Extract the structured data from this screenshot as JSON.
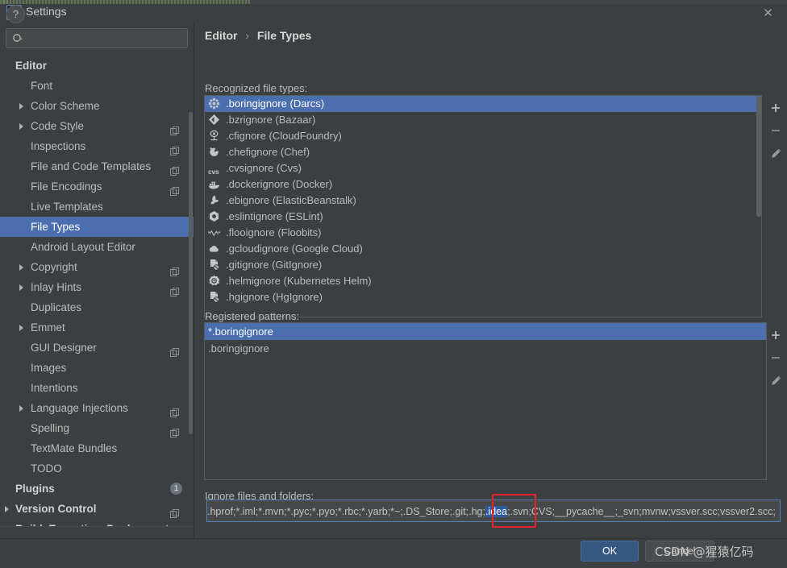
{
  "window": {
    "title": "Settings",
    "app_icon": "intellij-idea-icon",
    "close_icon": "close-icon"
  },
  "search": {
    "placeholder": "",
    "value": "",
    "icon": "search-icon"
  },
  "sidebar": {
    "scroll_present": true,
    "items": [
      {
        "label": "Editor",
        "level": 0,
        "bold": true,
        "arrow": false,
        "copy": false,
        "selected": false
      },
      {
        "label": "Font",
        "level": 1,
        "bold": false,
        "arrow": false,
        "copy": false,
        "selected": false
      },
      {
        "label": "Color Scheme",
        "level": 1,
        "bold": false,
        "arrow": true,
        "copy": false,
        "selected": false
      },
      {
        "label": "Code Style",
        "level": 1,
        "bold": false,
        "arrow": true,
        "copy": true,
        "selected": false
      },
      {
        "label": "Inspections",
        "level": 1,
        "bold": false,
        "arrow": false,
        "copy": true,
        "selected": false
      },
      {
        "label": "File and Code Templates",
        "level": 1,
        "bold": false,
        "arrow": false,
        "copy": true,
        "selected": false
      },
      {
        "label": "File Encodings",
        "level": 1,
        "bold": false,
        "arrow": false,
        "copy": true,
        "selected": false
      },
      {
        "label": "Live Templates",
        "level": 1,
        "bold": false,
        "arrow": false,
        "copy": false,
        "selected": false
      },
      {
        "label": "File Types",
        "level": 1,
        "bold": false,
        "arrow": false,
        "copy": false,
        "selected": true
      },
      {
        "label": "Android Layout Editor",
        "level": 1,
        "bold": false,
        "arrow": false,
        "copy": false,
        "selected": false
      },
      {
        "label": "Copyright",
        "level": 1,
        "bold": false,
        "arrow": true,
        "copy": true,
        "selected": false
      },
      {
        "label": "Inlay Hints",
        "level": 1,
        "bold": false,
        "arrow": true,
        "copy": true,
        "selected": false
      },
      {
        "label": "Duplicates",
        "level": 1,
        "bold": false,
        "arrow": false,
        "copy": false,
        "selected": false
      },
      {
        "label": "Emmet",
        "level": 1,
        "bold": false,
        "arrow": true,
        "copy": false,
        "selected": false
      },
      {
        "label": "GUI Designer",
        "level": 1,
        "bold": false,
        "arrow": false,
        "copy": true,
        "selected": false
      },
      {
        "label": "Images",
        "level": 1,
        "bold": false,
        "arrow": false,
        "copy": false,
        "selected": false
      },
      {
        "label": "Intentions",
        "level": 1,
        "bold": false,
        "arrow": false,
        "copy": false,
        "selected": false
      },
      {
        "label": "Language Injections",
        "level": 1,
        "bold": false,
        "arrow": true,
        "copy": true,
        "selected": false
      },
      {
        "label": "Spelling",
        "level": 1,
        "bold": false,
        "arrow": false,
        "copy": true,
        "selected": false
      },
      {
        "label": "TextMate Bundles",
        "level": 1,
        "bold": false,
        "arrow": false,
        "copy": false,
        "selected": false
      },
      {
        "label": "TODO",
        "level": 1,
        "bold": false,
        "arrow": false,
        "copy": false,
        "selected": false
      },
      {
        "label": "Plugins",
        "level": 0,
        "bold": true,
        "arrow": false,
        "copy": false,
        "selected": false,
        "badge": "1"
      },
      {
        "label": "Version Control",
        "level": 0,
        "bold": true,
        "arrow": true,
        "copy": true,
        "selected": false
      },
      {
        "label": "Build, Execution, Deployment",
        "level": 0,
        "bold": true,
        "arrow": true,
        "copy": false,
        "selected": false
      }
    ]
  },
  "breadcrumb": {
    "root": "Editor",
    "separator": "›",
    "current": "File Types"
  },
  "recognized": {
    "label": "Recognized file types:",
    "items": [
      {
        "name": ".boringignore (Darcs)",
        "icon": "darcs-icon",
        "selected": true
      },
      {
        "name": ".bzrignore (Bazaar)",
        "icon": "bazaar-icon",
        "selected": false
      },
      {
        "name": ".cfignore (CloudFoundry)",
        "icon": "cloudfoundry-icon",
        "selected": false
      },
      {
        "name": ".chefignore (Chef)",
        "icon": "chef-icon",
        "selected": false
      },
      {
        "name": ".cvsignore (Cvs)",
        "icon": "cvs-icon",
        "selected": false
      },
      {
        "name": ".dockerignore (Docker)",
        "icon": "docker-icon",
        "selected": false
      },
      {
        "name": ".ebignore (ElasticBeanstalk)",
        "icon": "elasticbeanstalk-icon",
        "selected": false
      },
      {
        "name": ".eslintignore (ESLint)",
        "icon": "eslint-icon",
        "selected": false
      },
      {
        "name": ".flooignore (Floobits)",
        "icon": "floobits-icon",
        "selected": false
      },
      {
        "name": ".gcloudignore (Google Cloud)",
        "icon": "google-cloud-icon",
        "selected": false
      },
      {
        "name": ".gitignore (GitIgnore)",
        "icon": "gitignore-icon",
        "selected": false
      },
      {
        "name": ".helmignore (Kubernetes Helm)",
        "icon": "helm-icon",
        "selected": false
      },
      {
        "name": ".hgignore (HgIgnore)",
        "icon": "hgignore-icon",
        "selected": false
      }
    ],
    "toolbar": [
      {
        "label": "+",
        "name": "add-file-type-button"
      },
      {
        "label": "−",
        "name": "remove-file-type-button"
      },
      {
        "label": "✎",
        "name": "edit-file-type-button"
      }
    ]
  },
  "patterns": {
    "label": "Registered patterns:",
    "items": [
      {
        "name": "*.boringignore",
        "selected": true
      },
      {
        "name": ".boringignore",
        "selected": false
      }
    ],
    "toolbar": [
      {
        "label": "+",
        "name": "add-pattern-button"
      },
      {
        "label": "−",
        "name": "remove-pattern-button"
      },
      {
        "label": "✎",
        "name": "edit-pattern-button"
      }
    ]
  },
  "ignore_field": {
    "label": "Ignore files and folders:",
    "text_before": ".hprof;*.iml;*.mvn;*.pyc;*.pyo;*.rbc;*.yarb;*~;.DS_Store;.git;.hg;",
    "text_selected": ".idea",
    "text_after": ";.svn;CVS;__pycache__;_svn;mvnw;vssver.scc;vssver2.scc;",
    "highlight_color": "#2f5a9e",
    "annotation_color": "#e8242a"
  },
  "footer": {
    "help_label": "?",
    "ok_label": "OK",
    "cancel_label": "Cancel",
    "watermark": "CSDN @猩猿亿码"
  },
  "colors": {
    "selection": "#4b6eaf",
    "background": "#3c3f41",
    "field_background": "#45494a",
    "ok_button": "#365880"
  }
}
